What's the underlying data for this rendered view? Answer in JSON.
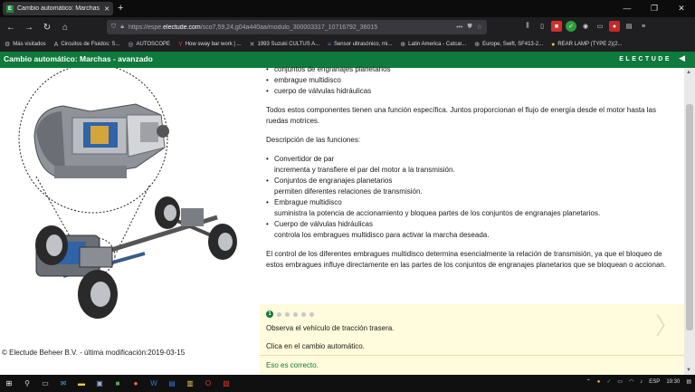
{
  "browser": {
    "tab_title": "Cambio automático: Marchas -",
    "tab_favicon": "E",
    "new_tab": "+",
    "url_prefix": "https://espe.",
    "url_host": "electude.com",
    "url_rest": "/sco7,59,24,g04a440aa/modulo_300003317_10716792_36015",
    "bookmarks": [
      {
        "icon": "gear-icon",
        "glyph": "⚙",
        "label": "Más visitados"
      },
      {
        "icon": "a-icon",
        "glyph": "A",
        "label": "Circuitos de Fluidos: S..."
      },
      {
        "icon": "globe-icon",
        "glyph": "◎",
        "label": "AUTOSCOPE"
      },
      {
        "icon": "y-icon",
        "glyph": "Y",
        "label": "How sway bar work | ..."
      },
      {
        "icon": "tool-icon",
        "glyph": "✕",
        "label": "1993 Suzuki CULTUS A..."
      },
      {
        "icon": "wave-icon",
        "glyph": "≈",
        "label": "Sensor ultrasónico, mi..."
      },
      {
        "icon": "globe-icon",
        "glyph": "⊕",
        "label": "Latin America - Catcar..."
      },
      {
        "icon": "globe-icon",
        "glyph": "⊕",
        "label": "Europe, Swift, SF413-2..."
      },
      {
        "icon": "lamp-icon",
        "glyph": "●",
        "label": "REAR LAMP (TYPE 2)(2..."
      }
    ]
  },
  "header": {
    "title": "Cambio automático: Marchas - avanzado",
    "brand": "ELECTUDE",
    "collapse": "◀"
  },
  "left": {
    "copyright": "© Electude Beheer B.V. - última modificación:2019-03-15"
  },
  "content": {
    "top_bullets": [
      "conjuntos de engranajes planetarios",
      "embrague multidisco",
      "cuerpo de válvulas hidráulicas"
    ],
    "para1": "Todos estos componentes tienen una función específica. Juntos proporcionan el flujo de energía desde el motor hasta las ruedas motrices.",
    "functions_title": "Descripción de las funciones:",
    "functions": [
      {
        "name": "Convertidor de par",
        "desc": "incrementa y transfiere el par del motor a la transmisión."
      },
      {
        "name": "Conjuntos de engranajes planetarios",
        "desc": "permiten diferentes relaciones de transmisión."
      },
      {
        "name": "Embrague multidisco",
        "desc": "suministra la potencia de accionamiento y bloquea partes de los conjuntos de engranajes planetarios."
      },
      {
        "name": "Cuerpo de válvulas hidráulicas",
        "desc": "controla los embragues multidisco para activar la marcha deseada."
      }
    ],
    "para2": "El control de los diferentes embragues multidisco determina esencialmente la relación de transmisión, ya que el bloqueo de estos embragues influye directamente en las partes de los conjuntos de engranajes planetarios que se bloquean o accionan."
  },
  "quiz": {
    "step": "1",
    "question1": "Observa el vehículo de tracción trasera.",
    "question2": "Clica en el cambio automático.",
    "feedback": "Eso es correcto.",
    "next": "〉"
  },
  "taskbar": {
    "lang": "ESP",
    "time": "19:30"
  },
  "colors": {
    "header_green": "#0e7a3b",
    "quiz_bg": "#fffbdc"
  }
}
